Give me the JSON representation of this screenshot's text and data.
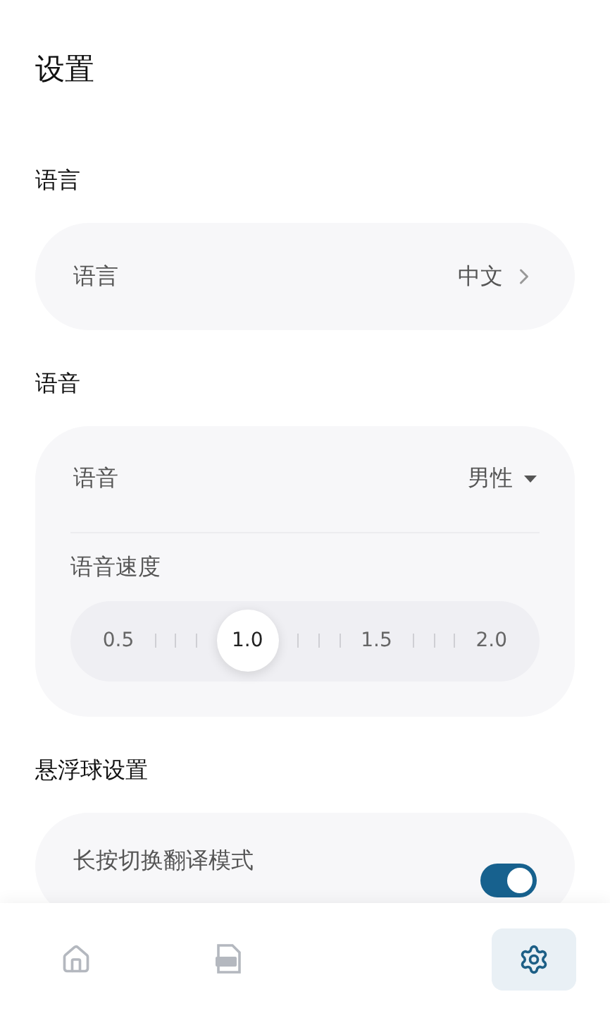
{
  "title": "设置",
  "sections": [
    {
      "heading": "语言",
      "rows": [
        {
          "kind": "link",
          "label": "语言",
          "value": "中文"
        }
      ]
    },
    {
      "heading": "语音",
      "rows": [
        {
          "kind": "dropdown",
          "label": "语音",
          "value": "男性"
        },
        {
          "kind": "slider",
          "label": "语音速度",
          "level": 0.3333,
          "stops": [
            "0.5",
            "1.0",
            "1.5",
            "2.0"
          ]
        }
      ]
    },
    {
      "heading": "悬浮球设置",
      "rows": [
        {
          "kind": "toggle",
          "label": "长按切换翻译模式",
          "on": true
        }
      ]
    }
  ],
  "nav": [
    {
      "kind": "home",
      "selected": false
    },
    {
      "kind": "pdf",
      "selected": false
    },
    {
      "kind": "settings",
      "selected": true
    }
  ]
}
